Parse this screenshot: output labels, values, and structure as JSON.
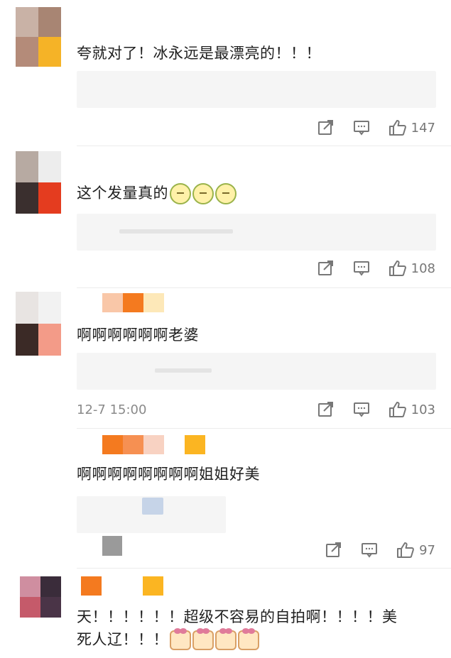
{
  "comments": [
    {
      "text": "夸就对了！冰永远是最漂亮的！！！",
      "likes": "147",
      "date": ""
    },
    {
      "text": "这个发量真的",
      "likes": "108",
      "date": ""
    },
    {
      "text": "啊啊啊啊啊啊老婆",
      "likes": "103",
      "date": "12-7 15:00"
    },
    {
      "text": "啊啊啊啊啊啊啊啊姐姐好美",
      "likes": "97",
      "date": ""
    },
    {
      "text_line1": "天！！！！！！超级不容易的自拍啊！！！！美",
      "text_line2": "死人辽！！！"
    }
  ],
  "icons": {
    "share": "share-icon",
    "comment": "comment-icon",
    "like": "thumbs-up-icon",
    "emoji_lemon": "lemon-face-emoji-icon",
    "emoji_blush": "blushing-face-emoji-icon"
  },
  "colors": {
    "accent_orange": "#f47a1f",
    "text": "#1f1f1f",
    "muted": "#8a8a8a"
  }
}
